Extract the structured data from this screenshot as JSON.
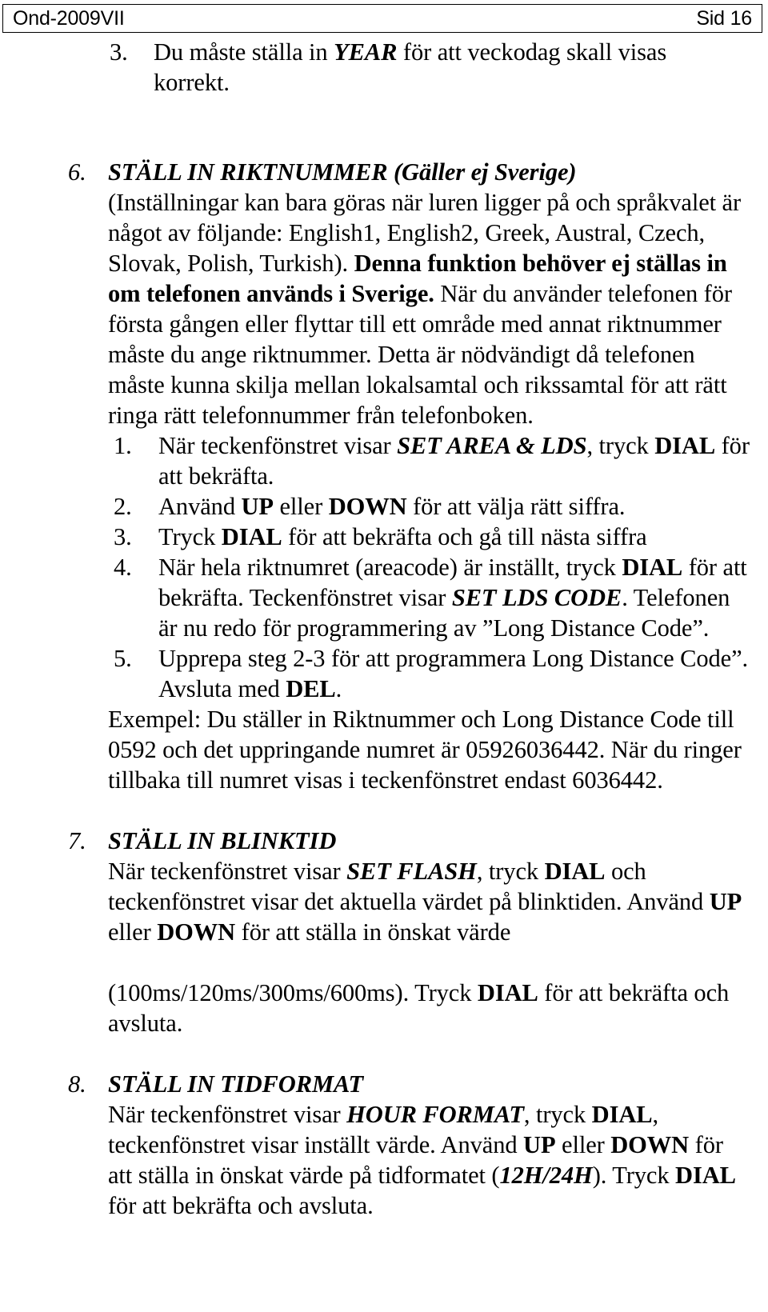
{
  "header": {
    "left": "Ond-2009VII",
    "right": "Sid 16"
  },
  "top_item": {
    "number": "3.",
    "line1_a": "Du måste ställa in ",
    "line1_em": "YEAR",
    "line1_b": " för att veckodag skall visas",
    "line2": "korrekt."
  },
  "sections": [
    {
      "number": "6.",
      "title": "STÄLL IN RIKTNUMMER (Gäller ej Sverige)",
      "intro_a": "(Inställningar kan bara göras när luren ligger på och språkvalet är något av följande: English1, English2, Greek, Austral, Czech, Slovak, Polish, Turkish). ",
      "intro_bold": "Denna funktion behöver ej ställas in om telefonen används i Sverige.",
      "intro_b": " När du använder telefonen för första gången eller flyttar till ett område med annat riktnummer måste du ange riktnummer. Detta är nödvändigt då telefonen måste kunna skilja mellan lokalsamtal och rikssamtal för att rätt ringa rätt telefonnummer från telefonboken.",
      "steps": [
        {
          "number": "1.",
          "a": "När teckenfönstret visar ",
          "em": "SET AREA & LDS",
          "b": ", tryck ",
          "strong": "DIAL",
          "c": " för att bekräfta."
        },
        {
          "number": "2.",
          "a": "Använd ",
          "strong1": "UP",
          "b": " eller ",
          "strong2": "DOWN",
          "c": " för att välja rätt siffra."
        },
        {
          "number": "3.",
          "a": "Tryck ",
          "strong1": "DIAL",
          "b": " för att bekräfta och gå till nästa siffra"
        },
        {
          "number": "4.",
          "a": "När hela riktnumret (areacode)  är inställt, tryck ",
          "strong1": "DIAL",
          "b": " för att bekräfta. Teckenfönstret visar ",
          "em": "SET LDS CODE",
          "c": ". Telefonen är nu redo för programmering av ”Long Distance Code”."
        },
        {
          "number": "5.",
          "a": "Upprepa steg 2-3 för att programmera Long Distance Code”. Avsluta med ",
          "strong1": "DEL",
          "b": "."
        }
      ],
      "example": "Exempel: Du ställer in Riktnummer och Long Distance Code till 0592 och det uppringande numret är 05926036442. När du ringer tillbaka till numret visas i teckenfönstret endast 6036442."
    },
    {
      "number": "7.",
      "title": "STÄLL IN BLINKTID",
      "body_a": "När teckenfönstret visar ",
      "body_em": "SET FLASH",
      "body_b": ", tryck ",
      "body_strong": "DIAL",
      "body_c": " och teckenfönstret visar det aktuella värdet på blinktiden. Använd ",
      "body_strong2": "UP",
      "body_d": " eller ",
      "body_strong3": "DOWN",
      "body_e": " för att ställa in önskat värde",
      "tail_a": "(100ms/120ms/300ms/600ms). Tryck ",
      "tail_strong": "DIAL",
      "tail_b": " för att bekräfta och avsluta."
    },
    {
      "number": "8.",
      "title": "STÄLL IN TIDFORMAT",
      "body_a": "När teckenfönstret visar ",
      "body_em": "HOUR FORMAT",
      "body_b": ", tryck ",
      "body_strong": "DIAL",
      "body_c": ", teckenfönstret visar inställt värde. Använd ",
      "body_strong2": "UP",
      "body_d": " eller ",
      "body_strong3": "DOWN",
      "body_e": " för att ställa in önskat värde på tidformatet (",
      "body_em2": "12H/24H",
      "body_f": "). Tryck ",
      "body_strong4": "DIAL",
      "body_g": " för att bekräfta och avsluta."
    }
  ]
}
